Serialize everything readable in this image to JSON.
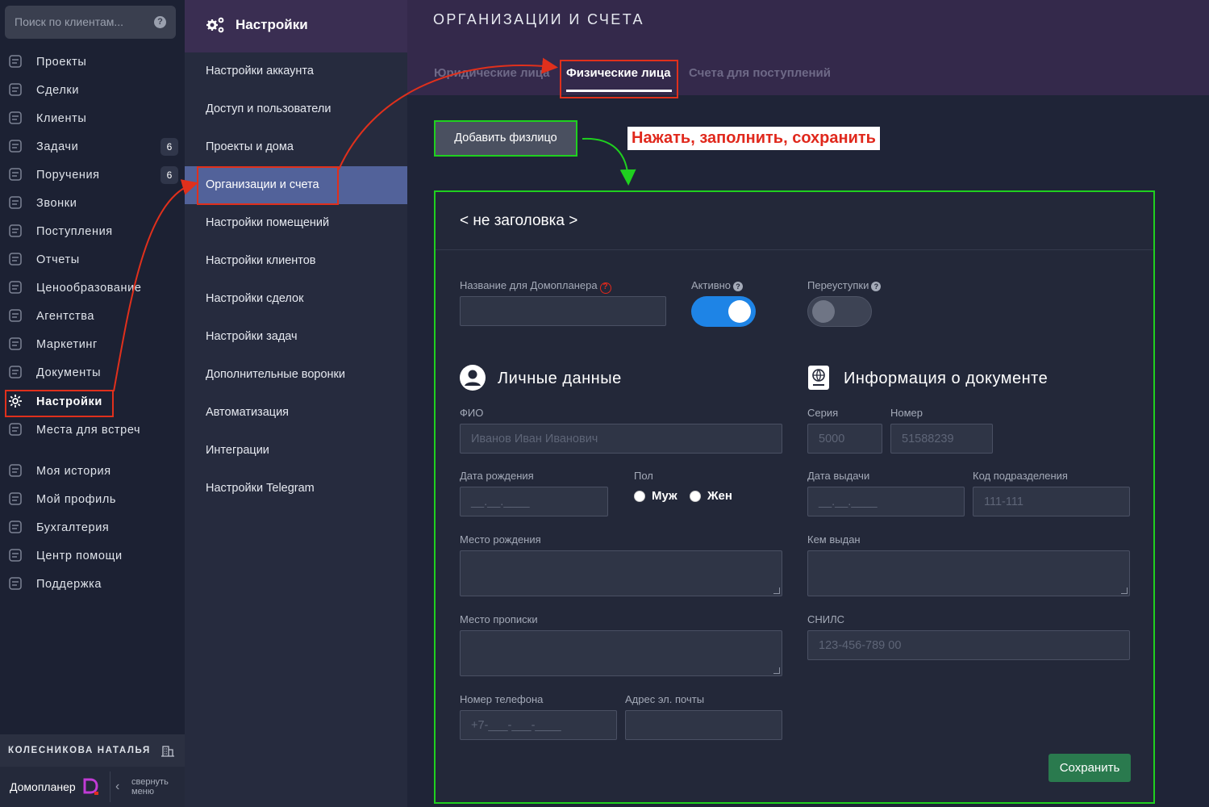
{
  "search": {
    "placeholder": "Поиск по клиентам...",
    "help": "?"
  },
  "nav": {
    "items": [
      {
        "label": "Проекты",
        "badge": ""
      },
      {
        "label": "Сделки",
        "badge": ""
      },
      {
        "label": "Клиенты",
        "badge": ""
      },
      {
        "label": "Задачи",
        "badge": "6"
      },
      {
        "label": "Поручения",
        "badge": "6"
      },
      {
        "label": "Звонки",
        "badge": ""
      },
      {
        "label": "Поступления",
        "badge": ""
      },
      {
        "label": "Отчеты",
        "badge": ""
      },
      {
        "label": "Ценообразование",
        "badge": ""
      },
      {
        "label": "Агентства",
        "badge": ""
      },
      {
        "label": "Маркетинг",
        "badge": ""
      },
      {
        "label": "Документы",
        "badge": ""
      },
      {
        "label": "Настройки",
        "badge": ""
      },
      {
        "label": "Места для встреч",
        "badge": ""
      },
      {
        "label": "Моя история",
        "badge": ""
      },
      {
        "label": "Мой профиль",
        "badge": ""
      },
      {
        "label": "Бухгалтерия",
        "badge": ""
      },
      {
        "label": "Центр помощи",
        "badge": ""
      },
      {
        "label": "Поддержка",
        "badge": ""
      }
    ],
    "user_name": "КОЛЕСНИКОВА НАТАЛЬЯ",
    "brand": "Домопланер",
    "collapse_line1": "свернуть",
    "collapse_line2": "меню"
  },
  "settings": {
    "title": "Настройки",
    "items": [
      "Настройки аккаунта",
      "Доступ и пользователи",
      "Проекты и дома",
      "Организации и счета",
      "Настройки помещений",
      "Настройки клиентов",
      "Настройки сделок",
      "Настройки задач",
      "Дополнительные воронки",
      "Автоматизация",
      "Интеграции",
      "Настройки Telegram"
    ],
    "active_index": 3
  },
  "main": {
    "page_title": "ОРГАНИЗАЦИИ И СЧЕТА",
    "tabs": [
      "Юридические лица",
      "Физические лица",
      "Счета для поступлений"
    ],
    "active_tab": 1,
    "add_button": "Добавить физлицо",
    "callout": "Нажать, заполнить, сохранить"
  },
  "form": {
    "card_title": "< не заголовка >",
    "name_label": "Название для Домопланера",
    "active_label": "Активно",
    "active_on": true,
    "transfers_label": "Переуступки",
    "transfers_on": false,
    "personal_title": "Личные данные",
    "doc_title": "Информация о документе",
    "fio_label": "ФИО",
    "fio_placeholder": "Иванов Иван Иванович",
    "birth_label": "Дата рождения",
    "birth_placeholder": "__.__.____",
    "gender_label": "Пол",
    "gender_male": "Муж",
    "gender_female": "Жен",
    "birthplace_label": "Место рождения",
    "registration_label": "Место прописки",
    "phone_label": "Номер телефона",
    "phone_placeholder": "+7-___-___-____",
    "email_label": "Адрес эл. почты",
    "series_label": "Серия",
    "series_placeholder": "5000",
    "number_label": "Номер",
    "number_placeholder": "51588239",
    "issue_date_label": "Дата выдачи",
    "issue_date_placeholder": "__.__.____",
    "dept_code_label": "Код подразделения",
    "dept_code_placeholder": "111-111",
    "issued_by_label": "Кем выдан",
    "snils_label": "СНИЛС",
    "snils_placeholder": "123-456-789 00",
    "save_button": "Сохранить"
  },
  "colors": {
    "accent_blue": "#1e84e6",
    "annotation_red": "#e0301c",
    "annotation_green": "#1fd01f",
    "save_green": "#2a7a4e",
    "brand_pink": "#c13bd6"
  }
}
